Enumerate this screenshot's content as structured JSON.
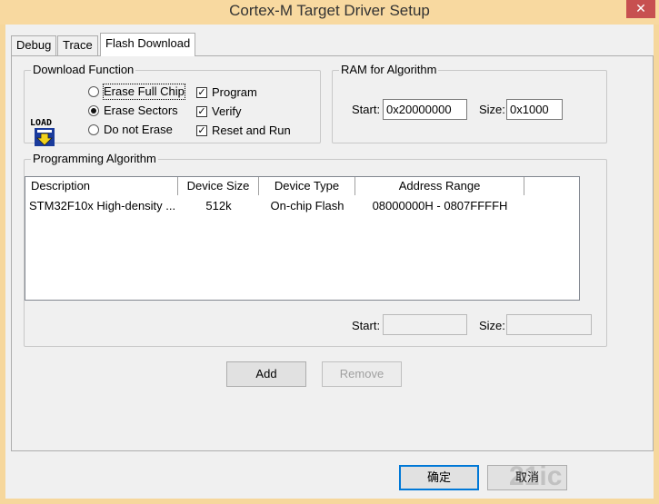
{
  "window": {
    "title": "Cortex-M Target Driver Setup",
    "close_glyph": "✕"
  },
  "tabs": [
    {
      "label": "Debug"
    },
    {
      "label": "Trace"
    },
    {
      "label": "Flash Download"
    }
  ],
  "download_function": {
    "title": "Download Function",
    "icon": "load-icon",
    "icon_text": "LOAD",
    "radios": [
      {
        "label": "Erase Full Chip",
        "selected": false
      },
      {
        "label": "Erase Sectors",
        "selected": true
      },
      {
        "label": "Do not Erase",
        "selected": false
      }
    ],
    "checks": [
      {
        "label": "Program",
        "checked": true
      },
      {
        "label": "Verify",
        "checked": true
      },
      {
        "label": "Reset and Run",
        "checked": true
      }
    ]
  },
  "ram_for_algorithm": {
    "title": "RAM for Algorithm",
    "start_label": "Start:",
    "start_value": "0x20000000",
    "size_label": "Size:",
    "size_value": "0x1000"
  },
  "programming_algorithm": {
    "title": "Programming Algorithm",
    "columns": [
      "Description",
      "Device Size",
      "Device Type",
      "Address Range"
    ],
    "rows": [
      [
        "STM32F10x High-density ...",
        "512k",
        "On-chip Flash",
        "08000000H - 0807FFFFH"
      ]
    ],
    "start_label": "Start:",
    "start_value": "",
    "size_label": "Size:",
    "size_value": ""
  },
  "buttons": {
    "add": "Add",
    "remove": "Remove",
    "ok": "确定",
    "cancel": "取消"
  },
  "watermark": "21ic"
}
